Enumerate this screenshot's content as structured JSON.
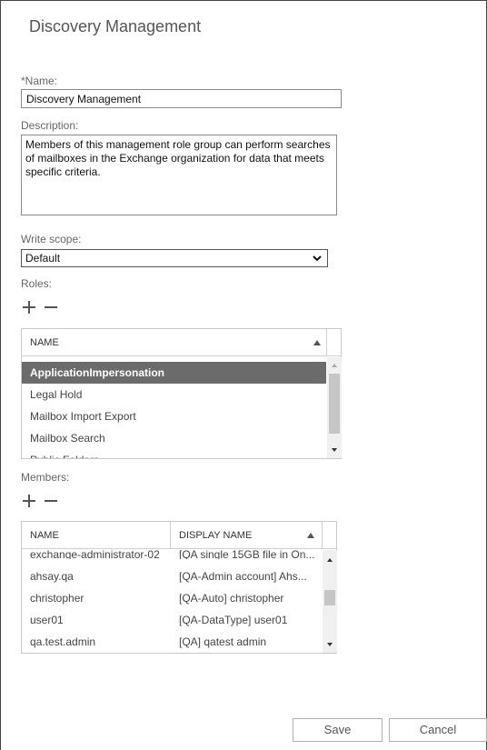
{
  "window": {
    "title": "Discovery Management"
  },
  "form": {
    "name_label": "*Name:",
    "name_value": "Discovery Management",
    "description_label": "Description:",
    "description_value": "Members of this management role group can perform searches of mailboxes in the Exchange organization for data that meets specific criteria.",
    "write_scope_label": "Write scope:",
    "write_scope_value": "Default",
    "roles_label": "Roles:",
    "members_label": "Members:"
  },
  "roles": {
    "columns": [
      "NAME"
    ],
    "rows": [
      {
        "name": "ApplicationImpersonation",
        "selected": true
      },
      {
        "name": "Legal Hold"
      },
      {
        "name": "Mailbox Import Export"
      },
      {
        "name": "Mailbox Search"
      },
      {
        "name": "Public Folders"
      }
    ]
  },
  "members": {
    "columns": [
      "NAME",
      "DISPLAY NAME"
    ],
    "rows": [
      {
        "name": "exchange-administrator-02",
        "display": "[QA single 15GB file in On..."
      },
      {
        "name": "ahsay.qa",
        "display": "[QA-Admin account] Ahs..."
      },
      {
        "name": "christopher",
        "display": "[QA-Auto] christopher"
      },
      {
        "name": "user01",
        "display": "[QA-DataType] user01"
      },
      {
        "name": "qa.test.admin",
        "display": "[QA] qatest admin"
      }
    ]
  },
  "buttons": {
    "save": "Save",
    "cancel": "Cancel"
  },
  "icons": {
    "add": "plus-icon",
    "remove": "minus-icon",
    "dropdown": "chevron-down-icon",
    "sort": "sort-up-icon"
  },
  "colors": {
    "selected_row": "#6b6b6b",
    "border": "#8a8a8a"
  }
}
